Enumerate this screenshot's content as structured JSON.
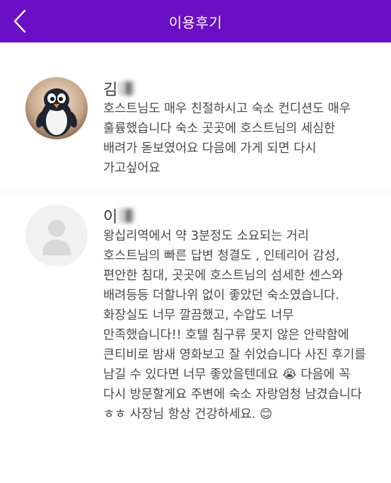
{
  "header": {
    "title": "이용후기",
    "back_icon": "chevron-left-icon",
    "bg_color": "#6a0fc6"
  },
  "reviews": [
    {
      "name": "김",
      "avatar_icon": "penguin-avatar",
      "text": "호스트님도 매우 친절하시고 숙소 컨디션도 매우 훌륭했습니다 숙소 곳곳에 호스트님의 세심한 배려가 돋보였어요 다음에 가게 되면 다시 가고싶어요"
    },
    {
      "name": "이",
      "avatar_icon": "default-user-avatar",
      "text": "왕십리역에서 약 3분정도 소요되는 거리 호스트님의 빠른 답변 청결도 , 인테리어 감성, 편안한 침대, 곳곳에 호스트님의 섬세한 센스와 배려등등 더할나위 없이 좋았던 숙소였습니다. 화장실도 너무 깔끔했고, 수압도 너무 만족했습니다!! 호텔 침구류 못지 않은 안락함에 큰티비로 밤새 영화보고 잘 쉬었습니다 사진 후기를 남길 수 있다면 너무 좋았을텐데요 😭 다음에 꼭 다시 방문할게요 주변에 숙소 자랑엄청 남겼습니다 ㅎㅎ 사장님 항상 건강하세요. 😊"
    }
  ]
}
